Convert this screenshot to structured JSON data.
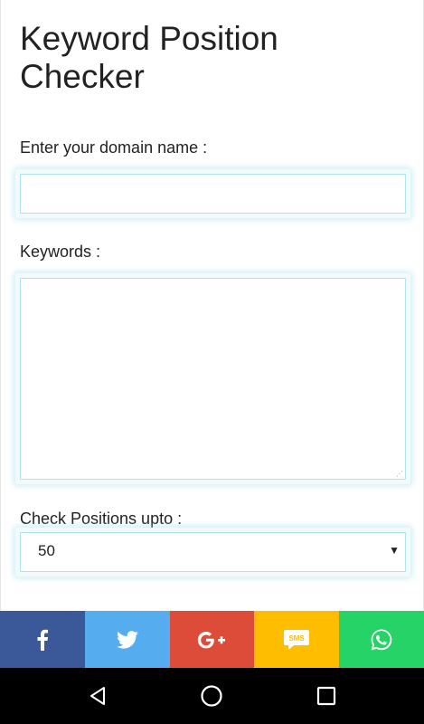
{
  "page": {
    "title": "Keyword Position Checker"
  },
  "form": {
    "domain_label": "Enter your domain name :",
    "domain_value": "",
    "keywords_label": "Keywords :",
    "keywords_value": "",
    "positions_label": "Check Positions upto :",
    "positions_selected": "50"
  },
  "share_bar": {
    "buttons": [
      {
        "name": "facebook",
        "icon": "facebook-icon",
        "color": "#3b5998"
      },
      {
        "name": "twitter",
        "icon": "twitter-icon",
        "color": "#55acee"
      },
      {
        "name": "google-plus",
        "icon": "google-plus-icon",
        "color": "#dd4b39"
      },
      {
        "name": "sms",
        "icon": "sms-icon",
        "color": "#ffbd00",
        "text": "SMS"
      },
      {
        "name": "whatsapp",
        "icon": "whatsapp-icon",
        "color": "#25d366"
      }
    ]
  },
  "navigation": {
    "buttons": [
      "back-icon",
      "home-icon",
      "recents-icon"
    ]
  }
}
